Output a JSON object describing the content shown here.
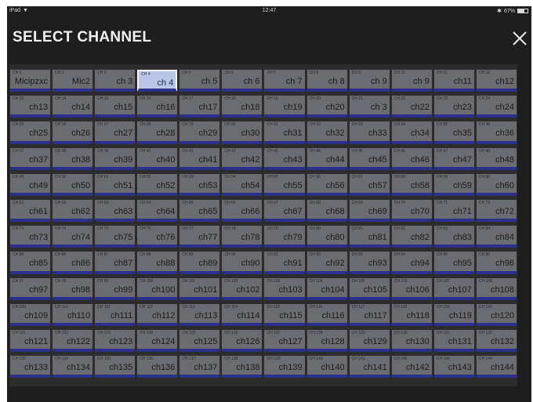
{
  "status": {
    "device": "iPad",
    "time": "12:47",
    "battery": "67%"
  },
  "title": "SELECT CHANNEL",
  "selected_channel": 4,
  "channels": [
    {
      "num": "CH 1",
      "name": "Micipzxc"
    },
    {
      "num": "CH 2",
      "name": "Mic2"
    },
    {
      "num": "CH 3",
      "name": "ch 3"
    },
    {
      "num": "CH 4",
      "name": "ch 4"
    },
    {
      "num": "CH 5",
      "name": "ch 5"
    },
    {
      "num": "CH 6",
      "name": "ch 6"
    },
    {
      "num": "CH 7",
      "name": "ch 7"
    },
    {
      "num": "CH 8",
      "name": "ch 8"
    },
    {
      "num": "CH 9",
      "name": "ch 9"
    },
    {
      "num": "CH 10",
      "name": "ch 9"
    },
    {
      "num": "CH 11",
      "name": "ch11"
    },
    {
      "num": "CH 12",
      "name": "ch12"
    },
    {
      "num": "CH 13",
      "name": "ch13"
    },
    {
      "num": "CH 14",
      "name": "ch14"
    },
    {
      "num": "CH 15",
      "name": "ch15"
    },
    {
      "num": "CH 16",
      "name": "ch16"
    },
    {
      "num": "CH 17",
      "name": "ch17"
    },
    {
      "num": "CH 18",
      "name": "ch18"
    },
    {
      "num": "CH 19",
      "name": "ch19"
    },
    {
      "num": "CH 20",
      "name": "ch20"
    },
    {
      "num": "CH 21",
      "name": "ch 3"
    },
    {
      "num": "CH 22",
      "name": "ch22"
    },
    {
      "num": "CH 23",
      "name": "ch23"
    },
    {
      "num": "CH 24",
      "name": "ch24"
    },
    {
      "num": "CH 25",
      "name": "ch25"
    },
    {
      "num": "CH 26",
      "name": "ch26"
    },
    {
      "num": "CH 27",
      "name": "ch27"
    },
    {
      "num": "CH 28",
      "name": "ch28"
    },
    {
      "num": "CH 29",
      "name": "ch29"
    },
    {
      "num": "CH 30",
      "name": "ch30"
    },
    {
      "num": "CH 31",
      "name": "ch31"
    },
    {
      "num": "CH 32",
      "name": "ch32"
    },
    {
      "num": "CH 33",
      "name": "ch33"
    },
    {
      "num": "CH 34",
      "name": "ch34"
    },
    {
      "num": "CH 35",
      "name": "ch35"
    },
    {
      "num": "CH 36",
      "name": "ch36"
    },
    {
      "num": "CH 37",
      "name": "ch37"
    },
    {
      "num": "CH 38",
      "name": "ch38"
    },
    {
      "num": "CH 39",
      "name": "ch39"
    },
    {
      "num": "CH 40",
      "name": "ch40"
    },
    {
      "num": "CH 41",
      "name": "ch41"
    },
    {
      "num": "CH 42",
      "name": "ch42"
    },
    {
      "num": "CH 43",
      "name": "ch43"
    },
    {
      "num": "CH 44",
      "name": "ch44"
    },
    {
      "num": "CH 45",
      "name": "ch45"
    },
    {
      "num": "CH 46",
      "name": "ch46"
    },
    {
      "num": "CH 47",
      "name": "ch47"
    },
    {
      "num": "CH 48",
      "name": "ch48"
    },
    {
      "num": "CH 49",
      "name": "ch49"
    },
    {
      "num": "CH 50",
      "name": "ch50"
    },
    {
      "num": "CH 51",
      "name": "ch51"
    },
    {
      "num": "CH 52",
      "name": "ch52"
    },
    {
      "num": "CH 53",
      "name": "ch53"
    },
    {
      "num": "CH 54",
      "name": "ch54"
    },
    {
      "num": "CH 55",
      "name": "ch55"
    },
    {
      "num": "CH 56",
      "name": "ch56"
    },
    {
      "num": "CH 57",
      "name": "ch57"
    },
    {
      "num": "CH 58",
      "name": "ch58"
    },
    {
      "num": "CH 59",
      "name": "ch59"
    },
    {
      "num": "CH 60",
      "name": "ch60"
    },
    {
      "num": "CH 61",
      "name": "ch61"
    },
    {
      "num": "CH 62",
      "name": "ch62"
    },
    {
      "num": "CH 63",
      "name": "ch63"
    },
    {
      "num": "CH 64",
      "name": "ch64"
    },
    {
      "num": "CH 65",
      "name": "ch65"
    },
    {
      "num": "CH 66",
      "name": "ch66"
    },
    {
      "num": "CH 67",
      "name": "ch67"
    },
    {
      "num": "CH 68",
      "name": "ch68"
    },
    {
      "num": "CH 69",
      "name": "ch69"
    },
    {
      "num": "CH 70",
      "name": "ch70"
    },
    {
      "num": "CH 71",
      "name": "ch71"
    },
    {
      "num": "CH 72",
      "name": "ch72"
    },
    {
      "num": "CH 73",
      "name": "ch73"
    },
    {
      "num": "CH 74",
      "name": "ch74"
    },
    {
      "num": "CH 75",
      "name": "ch75"
    },
    {
      "num": "CH 76",
      "name": "ch76"
    },
    {
      "num": "CH 77",
      "name": "ch77"
    },
    {
      "num": "CH 78",
      "name": "ch78"
    },
    {
      "num": "CH 79",
      "name": "ch79"
    },
    {
      "num": "CH 80",
      "name": "ch80"
    },
    {
      "num": "CH 81",
      "name": "ch81"
    },
    {
      "num": "CH 82",
      "name": "ch82"
    },
    {
      "num": "CH 83",
      "name": "ch83"
    },
    {
      "num": "CH 84",
      "name": "ch84"
    },
    {
      "num": "CH 85",
      "name": "ch85"
    },
    {
      "num": "CH 86",
      "name": "ch86"
    },
    {
      "num": "CH 87",
      "name": "ch87"
    },
    {
      "num": "CH 88",
      "name": "ch88"
    },
    {
      "num": "CH 89",
      "name": "ch89"
    },
    {
      "num": "CH 90",
      "name": "ch90"
    },
    {
      "num": "CH 91",
      "name": "ch91"
    },
    {
      "num": "CH 92",
      "name": "ch92"
    },
    {
      "num": "CH 93",
      "name": "ch93"
    },
    {
      "num": "CH 94",
      "name": "ch94"
    },
    {
      "num": "CH 95",
      "name": "ch95"
    },
    {
      "num": "CH 96",
      "name": "ch96"
    },
    {
      "num": "CH 97",
      "name": "ch97"
    },
    {
      "num": "CH 98",
      "name": "ch98"
    },
    {
      "num": "CH 99",
      "name": "ch99"
    },
    {
      "num": "CH 100",
      "name": "ch100"
    },
    {
      "num": "CH 101",
      "name": "ch101"
    },
    {
      "num": "CH 102",
      "name": "ch102"
    },
    {
      "num": "CH 103",
      "name": "ch103"
    },
    {
      "num": "CH 104",
      "name": "ch104"
    },
    {
      "num": "CH 105",
      "name": "ch105"
    },
    {
      "num": "CH 106",
      "name": "ch106"
    },
    {
      "num": "CH 107",
      "name": "ch107"
    },
    {
      "num": "CH 108",
      "name": "ch108"
    },
    {
      "num": "CH 109",
      "name": "ch109"
    },
    {
      "num": "CH 110",
      "name": "ch110"
    },
    {
      "num": "CH 111",
      "name": "ch111"
    },
    {
      "num": "CH 112",
      "name": "ch112"
    },
    {
      "num": "CH 113",
      "name": "ch113"
    },
    {
      "num": "CH 114",
      "name": "ch114"
    },
    {
      "num": "CH 115",
      "name": "ch115"
    },
    {
      "num": "CH 116",
      "name": "ch116"
    },
    {
      "num": "CH 117",
      "name": "ch117"
    },
    {
      "num": "CH 118",
      "name": "ch118"
    },
    {
      "num": "CH 119",
      "name": "ch119"
    },
    {
      "num": "CH 120",
      "name": "ch120"
    },
    {
      "num": "CH 121",
      "name": "ch121"
    },
    {
      "num": "CH 122",
      "name": "ch122"
    },
    {
      "num": "CH 123",
      "name": "ch123"
    },
    {
      "num": "CH 124",
      "name": "ch124"
    },
    {
      "num": "CH 125",
      "name": "ch125"
    },
    {
      "num": "CH 126",
      "name": "ch126"
    },
    {
      "num": "CH 127",
      "name": "ch127"
    },
    {
      "num": "CH 128",
      "name": "ch128"
    },
    {
      "num": "CH 129",
      "name": "ch129"
    },
    {
      "num": "CH 130",
      "name": "ch130"
    },
    {
      "num": "CH 131",
      "name": "ch131"
    },
    {
      "num": "CH 132",
      "name": "ch132"
    },
    {
      "num": "CH 133",
      "name": "ch133"
    },
    {
      "num": "CH 134",
      "name": "ch134"
    },
    {
      "num": "CH 135",
      "name": "ch135"
    },
    {
      "num": "CH 136",
      "name": "ch136"
    },
    {
      "num": "CH 137",
      "name": "ch137"
    },
    {
      "num": "CH 138",
      "name": "ch138"
    },
    {
      "num": "CH 139",
      "name": "ch139"
    },
    {
      "num": "CH 140",
      "name": "ch140"
    },
    {
      "num": "CH 141",
      "name": "ch141"
    },
    {
      "num": "CH 142",
      "name": "ch142"
    },
    {
      "num": "CH 143",
      "name": "ch143"
    },
    {
      "num": "CH 144",
      "name": "ch144"
    }
  ],
  "colors": {
    "background": "#1e1e1e",
    "panel": "#2c2c2c",
    "tile": "#6a6c71",
    "tile_selected": "#b9c6e6",
    "tile_underline": "#2c2f8c"
  },
  "icons": {
    "close": "close-icon",
    "wifi": "wifi-icon",
    "battery": "battery-icon",
    "bluetooth": "bluetooth-icon"
  }
}
